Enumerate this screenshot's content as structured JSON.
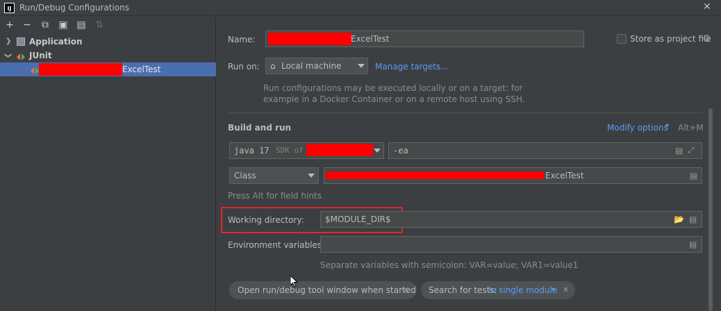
{
  "window": {
    "title": "Run/Debug Configurations",
    "app_icon_text": "IJ"
  },
  "toolbar": {
    "add": "+",
    "remove": "−",
    "copy": "⧉",
    "save": "▣",
    "folder": "▤",
    "sort": "⇅"
  },
  "tree": {
    "application": "Application",
    "junit": "JUnit",
    "selected_suffix": "ExcelTest"
  },
  "form": {
    "name_label": "Name:",
    "name_value_suffix": "ExcelTest",
    "store_label": "Store as project file",
    "run_on_label": "Run on:",
    "run_on_value": "Local machine",
    "manage_targets": "Manage targets...",
    "run_on_hint_1": "Run configurations may be executed locally or on a target: for",
    "run_on_hint_2": "example in a Docker Container or on a remote host using SSH.",
    "build_run_title": "Build and run",
    "modify_options": "Modify options",
    "modify_shortcut": "Alt+M",
    "sdk_prefix": "java 17",
    "sdk_of": "SDK of",
    "vm_options": "-ea",
    "kind_value": "Class",
    "class_suffix": "ExcelTest",
    "alt_hint": "Press Alt for field hints",
    "workdir_label": "Working directory:",
    "workdir_value": "$MODULE_DIR$",
    "env_label": "Environment variables:",
    "env_value": "",
    "env_hint": "Separate variables with semicolon: VAR=value; VAR1=value1"
  },
  "chips": {
    "open_tool_window": "Open run/debug tool window when started",
    "search_tests_label": "Search for tests:",
    "search_tests_value": "In single module"
  },
  "colors": {
    "accent": "#589df6",
    "selection": "#4b6eaf",
    "highlight": "#e0262b",
    "redaction": "#ff0000"
  }
}
